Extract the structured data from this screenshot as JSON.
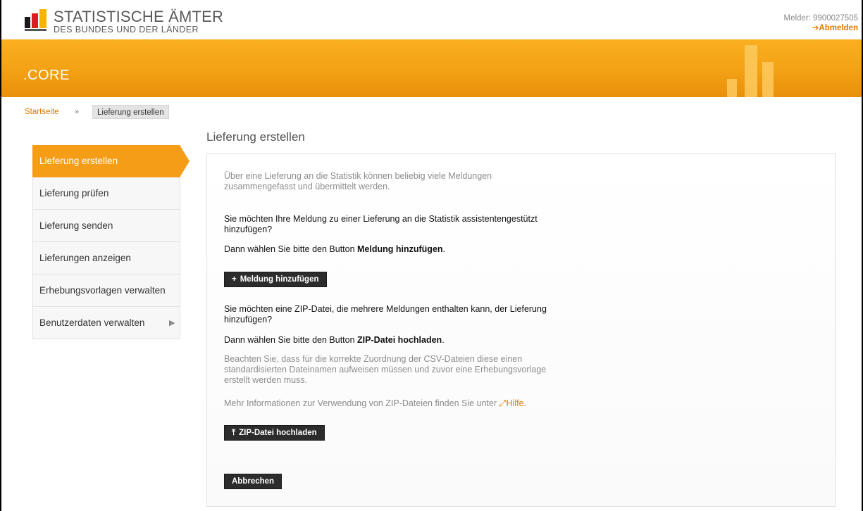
{
  "header": {
    "logo_line1": "STATISTISCHE ÄMTER",
    "logo_line2": "DES BUNDES UND DER LÄNDER",
    "melder_text": "Melder: 9900027505",
    "logout_label": "Abmelden",
    "logout_icon": "arrow-right-icon"
  },
  "banner": {
    "app_title": ".CORE",
    "colors": {
      "orange_top": "#f9b020",
      "orange_bottom": "#e98f0a",
      "accent": "#e07a00"
    }
  },
  "breadcrumb": {
    "home": "Startseite",
    "separator": "»",
    "current": "Lieferung erstellen"
  },
  "page": {
    "title": "Lieferung erstellen"
  },
  "sidebar": {
    "items": [
      {
        "label": "Lieferung erstellen",
        "active": true
      },
      {
        "label": "Lieferung prüfen"
      },
      {
        "label": "Lieferung senden"
      },
      {
        "label": "Lieferungen anzeigen"
      },
      {
        "label": "Erhebungsvorlagen verwalten"
      },
      {
        "label": "Benutzerdaten verwalten",
        "has_submenu": true
      }
    ]
  },
  "main": {
    "intro_line1": "Über eine Lieferung an die Statistik können beliebig viele Meldungen",
    "intro_line2": "zusammengefasst und übermittelt werden.",
    "q1_line1": "Sie möchten Ihre Meldung zu einer Lieferung an die Statistik assistentengestützt",
    "q1_line2": "hinzufügen?",
    "q1_hint_prefix": "Dann wählen Sie bitte den Button ",
    "q1_hint_bold": "Meldung hinzufügen",
    "q1_hint_suffix": ".",
    "add_button_label": "Meldung hinzufügen",
    "add_button_icon": "plus-icon",
    "q2_line1": "Sie möchten eine ZIP-Datei, die mehrere Meldungen enthalten kann, der Lieferung",
    "q2_line2": "hinzufügen?",
    "q2_hint_prefix": "Dann wählen Sie bitte den Button ",
    "q2_hint_bold": "ZIP-Datei hochladen",
    "q2_hint_suffix": ".",
    "note_line1": "Beachten Sie, dass für die korrekte Zuordnung der CSV-Dateien diese einen",
    "note_line2": "standardisierten Dateinamen aufweisen müssen und zuvor eine Erhebungsvorlage",
    "note_line3": "erstellt werden muss.",
    "more_info_text": "Mehr Informationen zur Verwendung von ZIP-Dateien finden Sie unter ",
    "help_link_label": "Hilfe",
    "help_link_icon": "external-link-icon",
    "help_link_suffix": ".",
    "upload_button_label": "ZIP-Datei hochladen",
    "upload_button_icon": "upload-icon",
    "cancel_button_label": "Abbrechen"
  }
}
